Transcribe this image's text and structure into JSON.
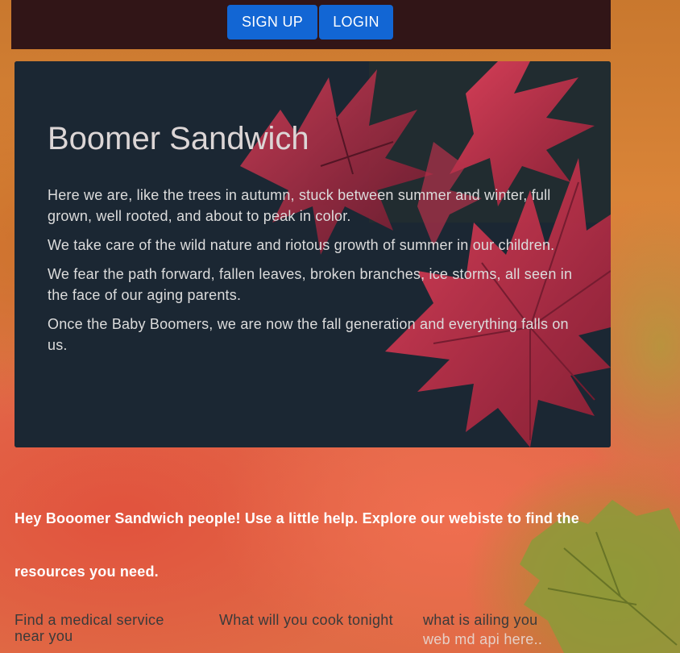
{
  "header": {
    "signup_label": "SIGN UP",
    "login_label": "LOGIN"
  },
  "hero": {
    "title": "Boomer Sandwich",
    "paragraphs": [
      "Here we are, like the trees in autumn, stuck between summer and winter, full grown, well rooted, and about to peak in color.",
      "We take care of the wild nature and riotous growth of summer in our children.",
      "We fear the path forward, fallen leaves, broken branches, ice storms, all seen in the face of our aging parents.",
      "Once the Baby Boomers, we are now the fall generation and everything falls on us."
    ]
  },
  "tagline": "Hey Booomer Sandwich people! Use a little help. Explore our webiste to find the resources you need.",
  "links": [
    {
      "label": "Find a medical service near you"
    },
    {
      "label": "What will you cook tonight"
    },
    {
      "label": "what is ailing you",
      "sub": "web md api here.."
    }
  ],
  "colors": {
    "topbar": "#311517",
    "button": "#1266d4",
    "hero_bg": "#1b2733"
  }
}
